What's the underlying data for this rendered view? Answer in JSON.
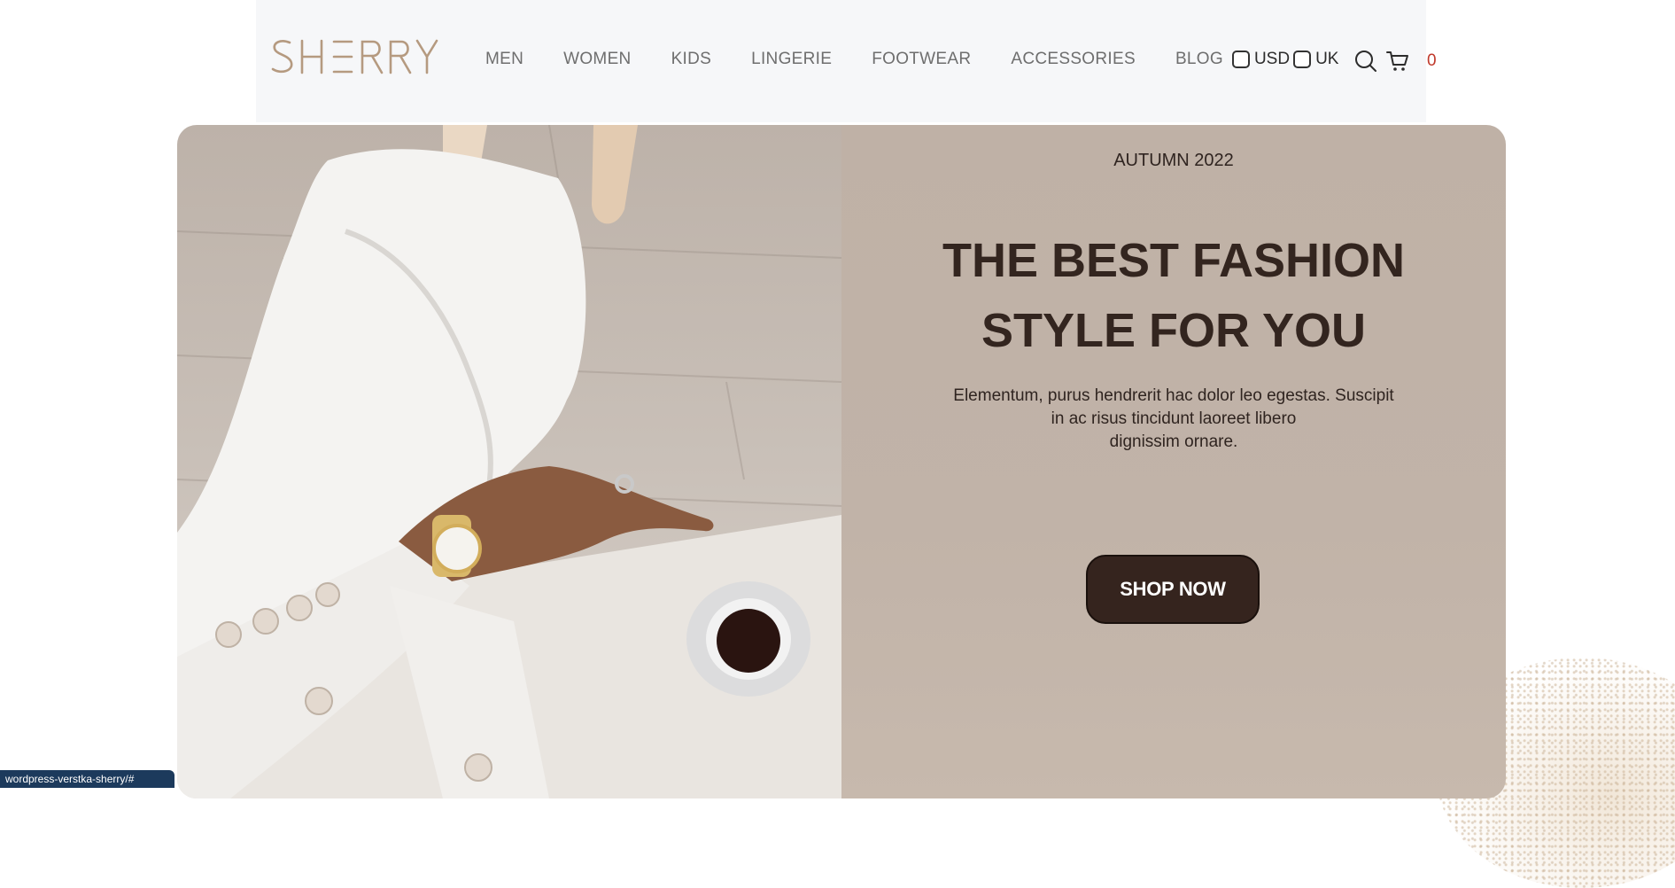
{
  "brand": {
    "logo_text": "SHERRY",
    "logo_color": "#b59a80"
  },
  "nav": {
    "items": [
      {
        "label": "MEN"
      },
      {
        "label": "WOMEN"
      },
      {
        "label": "KIDS"
      },
      {
        "label": "LINGERIE"
      },
      {
        "label": "FOOTWEAR"
      },
      {
        "label": "ACCESSORIES"
      },
      {
        "label": "BLOG"
      }
    ],
    "currency_label": "USD",
    "region_label": "UK",
    "cart_count": "0"
  },
  "hero": {
    "season": "AUTUMN 2022",
    "headline_line1": "THE BEST FASHION",
    "headline_line2": "STYLE FOR YOU",
    "description_line1": "Elementum, purus hendrerit hac dolor leo egestas. Suscipit",
    "description_line2": "in ac risus tincidunt laoreet libero",
    "description_line3": "dignissim ornare.",
    "cta_label": "SHOP NOW"
  },
  "status": {
    "url": "wordpress-verstka-sherry/#"
  },
  "colors": {
    "accent": "#35241e",
    "panel": "#bfb1a6",
    "cart_count": "#c0392b"
  }
}
